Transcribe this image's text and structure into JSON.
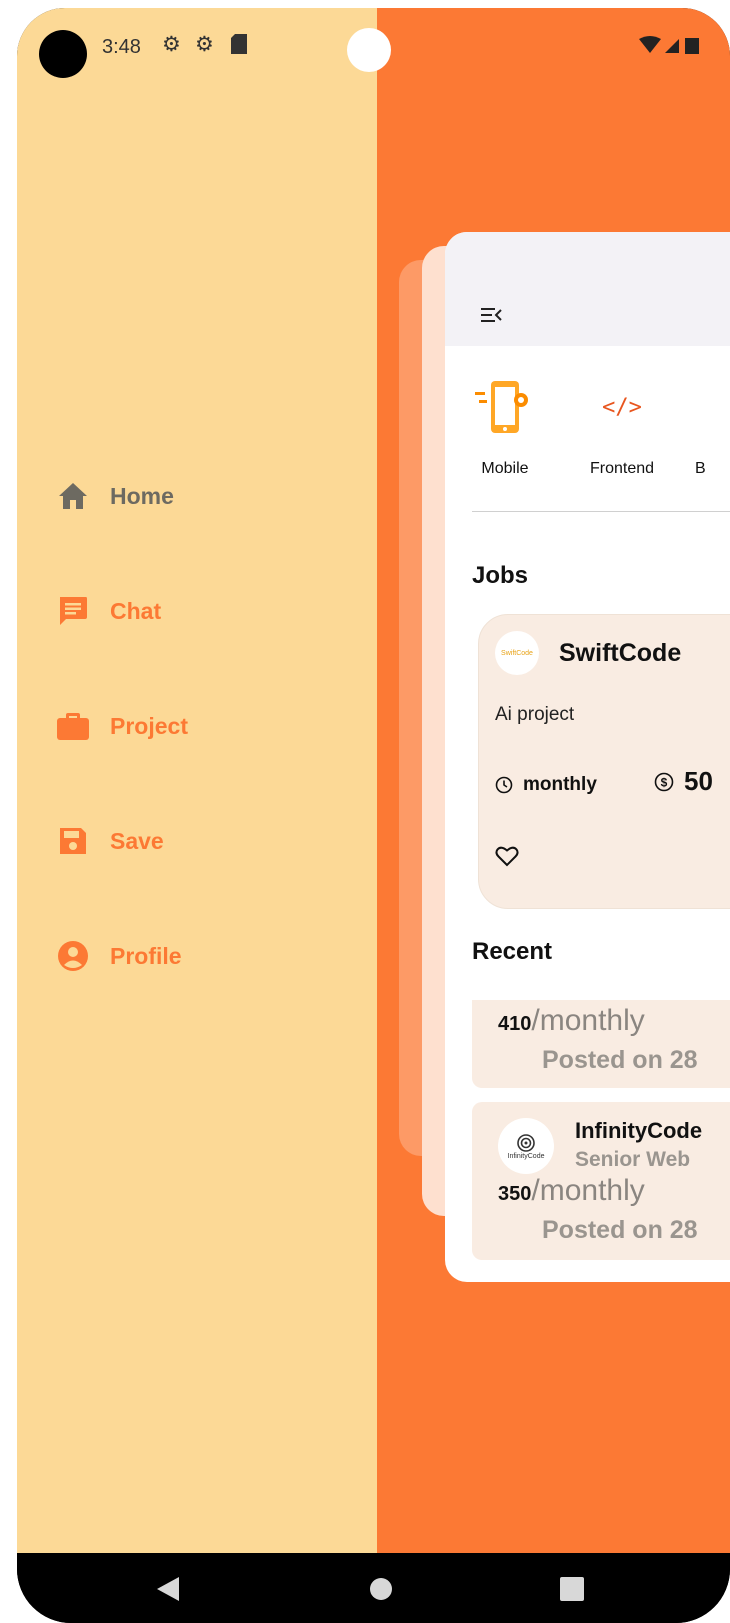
{
  "status_bar": {
    "time": "3:48"
  },
  "drawer": {
    "items": [
      {
        "label": "Home",
        "icon": "home-icon",
        "state": "muted"
      },
      {
        "label": "Chat",
        "icon": "chat-icon",
        "state": "active"
      },
      {
        "label": "Project",
        "icon": "briefcase-icon",
        "state": "active"
      },
      {
        "label": "Save",
        "icon": "save-icon",
        "state": "active"
      },
      {
        "label": "Profile",
        "icon": "profile-icon",
        "state": "active"
      }
    ]
  },
  "categories": [
    {
      "label": "Mobile",
      "icon": "mobile-icon"
    },
    {
      "label": "Frontend",
      "icon": "code-icon"
    },
    {
      "label": "B"
    }
  ],
  "jobs": {
    "title": "Jobs",
    "card": {
      "logo_text": "SwiftCode",
      "company": "SwiftCode",
      "description": "Ai project",
      "period": "monthly",
      "salary": "50"
    }
  },
  "recent": {
    "title": "Recent",
    "items": [
      {
        "rate": "410",
        "period": "/monthly",
        "posted": "Posted on 28"
      },
      {
        "logo_text": "InfinityCode",
        "company": "InfinityCode",
        "role": "Senior Web",
        "rate": "350",
        "period": "/monthly",
        "posted": "Posted on 28"
      }
    ]
  },
  "colors": {
    "drawer_bg": "#FCD996",
    "accent": "#FC7934",
    "card_bg": "#F9ECE2"
  }
}
